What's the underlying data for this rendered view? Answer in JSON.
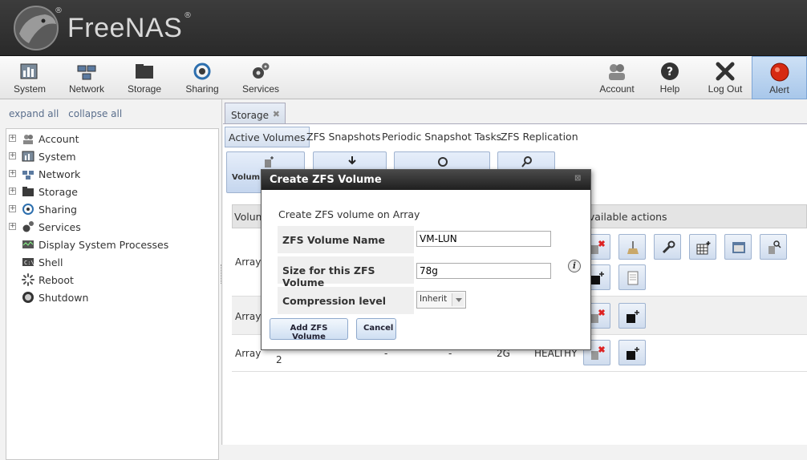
{
  "header": {
    "logo_text": "FreeNAS",
    "reg_mark": "®"
  },
  "toolbar": {
    "items": [
      {
        "label": "System"
      },
      {
        "label": "Network"
      },
      {
        "label": "Storage"
      },
      {
        "label": "Sharing"
      },
      {
        "label": "Services"
      },
      {
        "label": "Account"
      },
      {
        "label": "Help"
      },
      {
        "label": "Log Out"
      },
      {
        "label": "Alert"
      }
    ]
  },
  "sidebar": {
    "expand_all": "expand all",
    "collapse_all": "collapse all",
    "items": [
      {
        "label": "Account",
        "icon": "account-icon"
      },
      {
        "label": "System",
        "icon": "system-icon"
      },
      {
        "label": "Network",
        "icon": "network-icon"
      },
      {
        "label": "Storage",
        "icon": "storage-icon"
      },
      {
        "label": "Sharing",
        "icon": "sharing-icon"
      },
      {
        "label": "Services",
        "icon": "services-icon"
      },
      {
        "label": "Display System Processes",
        "icon": "processes-icon"
      },
      {
        "label": "Shell",
        "icon": "shell-icon"
      },
      {
        "label": "Reboot",
        "icon": "reboot-icon"
      },
      {
        "label": "Shutdown",
        "icon": "shutdown-icon"
      }
    ]
  },
  "main": {
    "tab_label": "Storage",
    "tab_close": "✖",
    "subtabs": [
      "Active Volumes",
      "ZFS Snapshots",
      "Periodic Snapshot Tasks",
      "ZFS Replication"
    ],
    "action_btn_label": "Volum",
    "grid": {
      "col_volume": "Volum",
      "col_actions": "Available actions",
      "rows": [
        {
          "volume": "Array"
        },
        {
          "volume": "Array"
        },
        {
          "volume": "Array",
          "name_fragment": "2",
          "used": "-",
          "avail": "-",
          "size": "2G",
          "status": "HEALTHY"
        }
      ]
    }
  },
  "dialog": {
    "title": "Create ZFS Volume",
    "intro": "Create ZFS volume on Array",
    "fields": {
      "name_label": "ZFS Volume Name",
      "name_value": "VM-LUN",
      "size_label": "Size for this ZFS Volume",
      "size_value": "78g",
      "compression_label": "Compression level",
      "compression_value": "Inherit"
    },
    "info_glyph": "i",
    "add_button": "Add ZFS Volume",
    "cancel_button": "Cancel"
  },
  "colors": {
    "header_bg": "#2f2f2f",
    "dialog_title_bg": "#2a2a2a",
    "accent_blue": "#c5d6ee",
    "alert_red": "#d62a12"
  }
}
